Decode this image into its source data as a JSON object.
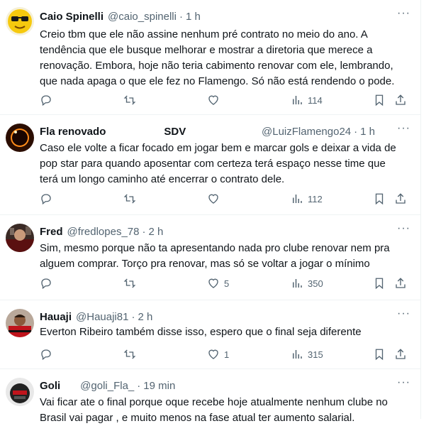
{
  "tweets": [
    {
      "name": "Caio Spinelli",
      "handle": "@caio_spinelli",
      "time": "1 h",
      "text_lines": [
        "Creio tbm que ele não assine nenhum pré contrato no meio do ano. A",
        "tendência que ele busque melhorar e mostrar a diretoria que merece a",
        "renovação. Embora, hoje não teria cabimento renovar com ele, lembrando,",
        "que nada apaga o que ele fez no Flamengo. Só não está rendendo o pode."
      ],
      "replies": "",
      "retweets": "",
      "likes": "",
      "views": "114",
      "avatar_icon": "sunglasses-emoji-avatar"
    },
    {
      "name": "Fla renovado",
      "name_suffix": "SDV",
      "handle": "@LuizFlamengo24",
      "time": "1 h",
      "text_lines": [
        "Caso ele volte a ficar focado em jogar bem e marcar gols e deixar a vida de",
        "pop star para quando aposentar com certeza terá espaço nesse time que",
        "terá um longo caminho até encerrar o contrato dele."
      ],
      "replies": "",
      "retweets": "",
      "likes": "",
      "views": "112",
      "avatar_icon": "eclipse-avatar"
    },
    {
      "name": "Fred",
      "handle": "@fredlopes_78",
      "time": "2 h",
      "text_lines": [
        "Sim, mesmo porque não ta apresentando nada pro clube renovar nem pra",
        "alguem comprar. Torço pra renovar, mas só se voltar a jogar o mínimo"
      ],
      "replies": "",
      "retweets": "",
      "likes": "5",
      "views": "350",
      "avatar_icon": "photo-avatar"
    },
    {
      "name": "Hauaji",
      "handle": "@Hauaji81",
      "time": "2 h",
      "text_lines": [
        "Everton Ribeiro também disse isso, espero que o final seja diferente"
      ],
      "replies": "",
      "retweets": "",
      "likes": "1",
      "views": "315",
      "avatar_icon": "player-avatar"
    },
    {
      "name": "Goli",
      "handle": "@goli_Fla_",
      "time": "19 min",
      "text_lines": [
        "Vai ficar ate o final porque oque recebe hoje atualmente nenhum clube no",
        "Brasil vai pagar , e muito menos na fase atual ter aumento salarial."
      ],
      "avatar_icon": "helmet-avatar"
    }
  ],
  "dot": "·",
  "more_label": "···",
  "colors": {
    "text": "#0f1419",
    "secondary": "#536471",
    "border": "#eff3f4"
  }
}
